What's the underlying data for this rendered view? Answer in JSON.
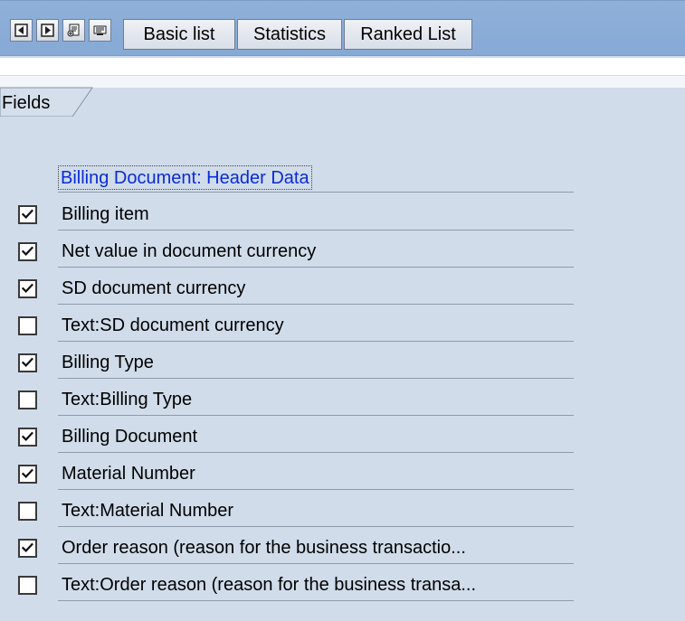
{
  "toolbar": {
    "buttons": [
      {
        "label": "Basic list"
      },
      {
        "label": "Statistics"
      },
      {
        "label": "Ranked List"
      }
    ]
  },
  "tab": {
    "label": "Fields"
  },
  "section": {
    "title": "Billing Document: Header Data"
  },
  "fields": [
    {
      "label": "Billing item",
      "checked": true
    },
    {
      "label": "Net value in document currency",
      "checked": true
    },
    {
      "label": "SD document currency",
      "checked": true
    },
    {
      "label": "Text:SD document currency",
      "checked": false
    },
    {
      "label": "Billing Type",
      "checked": true
    },
    {
      "label": "Text:Billing Type",
      "checked": false
    },
    {
      "label": "Billing Document",
      "checked": true
    },
    {
      "label": "Material Number",
      "checked": true
    },
    {
      "label": "Text:Material Number",
      "checked": false
    },
    {
      "label": "Order reason (reason for the business transactio...",
      "checked": true
    },
    {
      "label": "Text:Order reason (reason for the business transa...",
      "checked": false
    }
  ]
}
